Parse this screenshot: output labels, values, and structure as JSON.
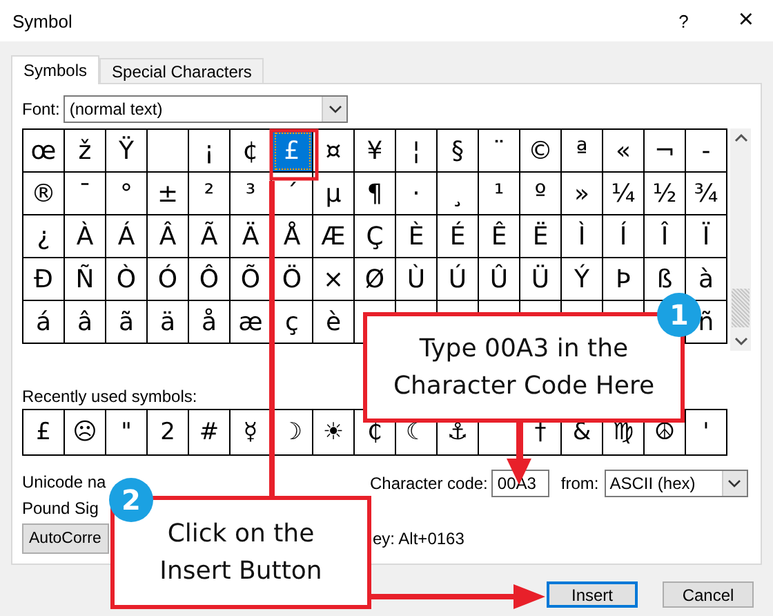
{
  "window": {
    "title": "Symbol",
    "help_button": "?",
    "close_button": "×"
  },
  "tabs": [
    {
      "label": "Symbols",
      "selected": true
    },
    {
      "label": "Special Characters",
      "selected": false
    }
  ],
  "font": {
    "label": "Font:",
    "value": "(normal text)"
  },
  "symbol_grid": {
    "rows": [
      [
        {
          "char": "œ",
          "selected": false
        },
        {
          "char": "ž",
          "selected": false
        },
        {
          "char": "Ÿ",
          "selected": false
        },
        {
          "selected": false
        },
        {
          "char": "¡",
          "selected": false
        },
        {
          "char": "¢",
          "selected": false
        },
        {
          "char": "£",
          "selected": true
        },
        {
          "char": "¤",
          "selected": false
        },
        {
          "char": "¥",
          "selected": false
        },
        {
          "char": "¦",
          "selected": false
        },
        {
          "char": "§",
          "selected": false
        },
        {
          "char": "¨",
          "selected": false
        },
        {
          "char": "©",
          "selected": false
        },
        {
          "char": "ª",
          "selected": false
        },
        {
          "char": "«",
          "selected": false
        },
        {
          "char": "¬",
          "selected": false
        },
        {
          "char": "-",
          "selected": false
        }
      ],
      [
        {
          "char": "®",
          "selected": false
        },
        {
          "char": "¯",
          "selected": false
        },
        {
          "char": "°",
          "selected": false
        },
        {
          "char": "±",
          "selected": false
        },
        {
          "char": "²",
          "selected": false
        },
        {
          "char": "³",
          "selected": false
        },
        {
          "char": "´",
          "selected": false
        },
        {
          "char": "µ",
          "selected": false
        },
        {
          "char": "¶",
          "selected": false
        },
        {
          "char": "·",
          "selected": false
        },
        {
          "char": "¸",
          "selected": false
        },
        {
          "char": "¹",
          "selected": false
        },
        {
          "char": "º",
          "selected": false
        },
        {
          "char": "»",
          "selected": false
        },
        {
          "char": "¼",
          "selected": false
        },
        {
          "char": "½",
          "selected": false
        },
        {
          "char": "¾",
          "selected": false
        }
      ],
      [
        {
          "char": "¿",
          "selected": false
        },
        {
          "char": "À",
          "selected": false
        },
        {
          "char": "Á",
          "selected": false
        },
        {
          "char": "Â",
          "selected": false
        },
        {
          "char": "Ã",
          "selected": false
        },
        {
          "char": "Ä",
          "selected": false
        },
        {
          "char": "Å",
          "selected": false
        },
        {
          "char": "Æ",
          "selected": false
        },
        {
          "char": "Ç",
          "selected": false
        },
        {
          "char": "È",
          "selected": false
        },
        {
          "char": "É",
          "selected": false
        },
        {
          "char": "Ê",
          "selected": false
        },
        {
          "char": "Ë",
          "selected": false
        },
        {
          "char": "Ì",
          "selected": false
        },
        {
          "char": "Í",
          "selected": false
        },
        {
          "char": "Î",
          "selected": false
        },
        {
          "char": "Ï",
          "selected": false
        }
      ],
      [
        {
          "char": "Ð",
          "selected": false
        },
        {
          "char": "Ñ",
          "selected": false
        },
        {
          "char": "Ò",
          "selected": false
        },
        {
          "char": "Ó",
          "selected": false
        },
        {
          "char": "Ô",
          "selected": false
        },
        {
          "char": "Õ",
          "selected": false
        },
        {
          "char": "Ö",
          "selected": false
        },
        {
          "char": "×",
          "selected": false
        },
        {
          "char": "Ø",
          "selected": false
        },
        {
          "char": "Ù",
          "selected": false
        },
        {
          "char": "Ú",
          "selected": false
        },
        {
          "char": "Û",
          "selected": false
        },
        {
          "char": "Ü",
          "selected": false
        },
        {
          "char": "Ý",
          "selected": false
        },
        {
          "char": "Þ",
          "selected": false
        },
        {
          "char": "ß",
          "selected": false
        },
        {
          "char": "à",
          "selected": false
        }
      ],
      [
        {
          "char": "á",
          "selected": false
        },
        {
          "char": "â",
          "selected": false
        },
        {
          "char": "ã",
          "selected": false
        },
        {
          "char": "ä",
          "selected": false
        },
        {
          "char": "å",
          "selected": false
        },
        {
          "char": "æ",
          "selected": false
        },
        {
          "char": "ç",
          "selected": false
        },
        {
          "char": "è",
          "selected": false
        },
        {
          "selected": false
        },
        {
          "selected": false
        },
        {
          "selected": false
        },
        {
          "selected": false
        },
        {
          "selected": false
        },
        {
          "selected": false
        },
        {
          "selected": false
        },
        {
          "selected": false
        },
        {
          "char": "ñ",
          "selected": false
        }
      ]
    ]
  },
  "recently_used": {
    "label": "Recently used symbols:",
    "symbols": [
      {
        "char": "£"
      },
      {
        "char": "☹"
      },
      {
        "char": "\""
      },
      {
        "char": "2"
      },
      {
        "char": "#"
      },
      {
        "char": "☿"
      },
      {
        "char": "☽"
      },
      {
        "char": "☀"
      },
      {
        "char": "₵"
      },
      {
        "char": "☾"
      },
      {
        "char": "⚓"
      },
      {
        "kind": "blank"
      },
      {
        "char": "†"
      },
      {
        "char": "&"
      },
      {
        "char": "♍"
      },
      {
        "char": "☮"
      },
      {
        "char": "'"
      }
    ]
  },
  "unicode_name": {
    "label": "Unicode na",
    "value": "Pound Sig"
  },
  "character_code": {
    "label": "Character code:",
    "value": "00A3"
  },
  "from": {
    "label": "from:",
    "value": "ASCII (hex)"
  },
  "autocorrect_button": "AutoCorre",
  "shortcut": "ey: Alt+0163",
  "buttons": [
    {
      "label": "Insert",
      "default": true
    },
    {
      "label": "Cancel",
      "default": false
    }
  ],
  "annotations": [
    {
      "number": "1",
      "lines": [
        "Type 00A3 in the",
        "Character Code Here"
      ]
    },
    {
      "number": "2",
      "lines": [
        "Click on the",
        "Insert Button"
      ]
    }
  ]
}
